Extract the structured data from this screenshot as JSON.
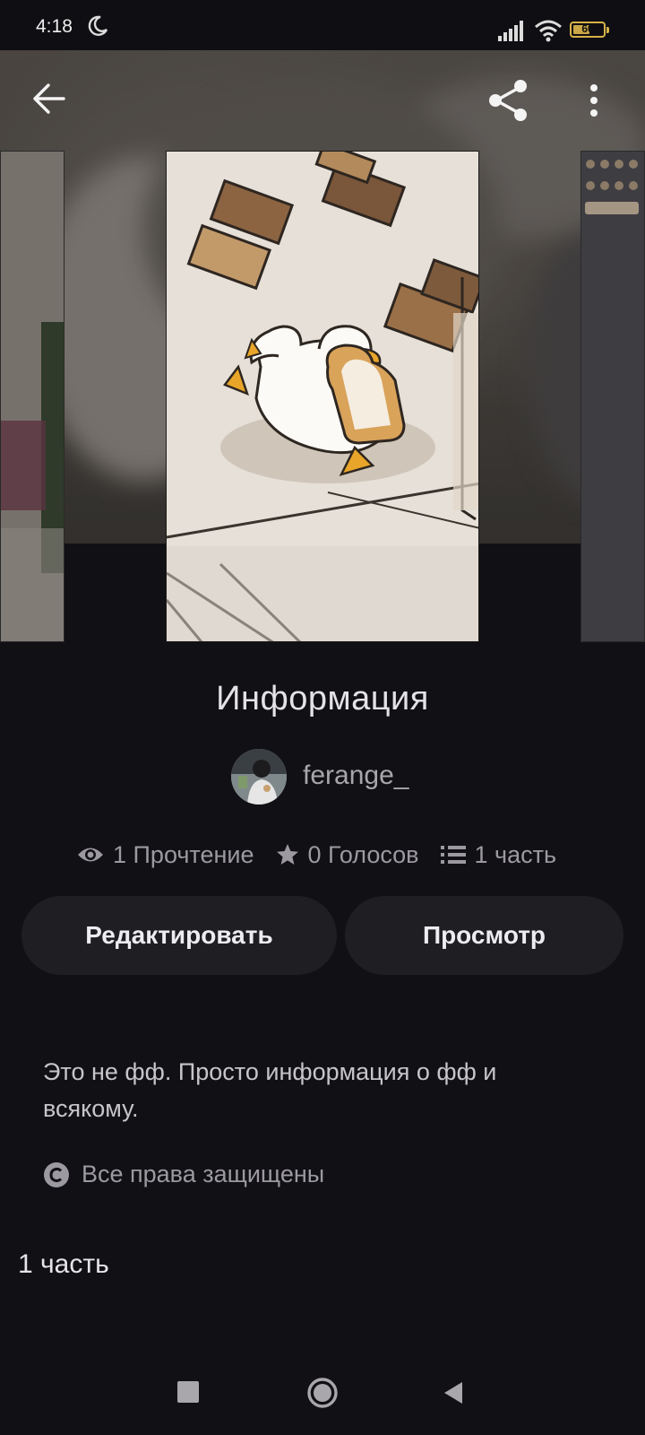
{
  "status_bar": {
    "time": "4:18",
    "battery_label": "60",
    "battery_level": 0.6,
    "icons": [
      "moon-icon",
      "signal-icon",
      "wifi-icon",
      "battery-icon"
    ]
  },
  "toolbar": {
    "icons": [
      "back-arrow-icon",
      "share-icon",
      "more-vert-icon"
    ]
  },
  "carousel": {
    "covers": [
      "cover-left",
      "cover-main-duck-illustration",
      "cover-right"
    ]
  },
  "story": {
    "title": "Информация",
    "author": "ferange_",
    "stats": {
      "reads": "1 Прочтение",
      "votes": "0 Голосов",
      "parts": "1 часть"
    },
    "edit_label": "Редактировать",
    "preview_label": "Просмотр",
    "description": "Это не фф. Просто информация о фф и всякому.",
    "copyright": "Все права защищены",
    "parts_heading": "1 часть"
  },
  "colors": {
    "background": "#111014",
    "button_bg": "#1f1e23",
    "muted_text": "#9c9aa0",
    "battery": "#d6b24a"
  }
}
